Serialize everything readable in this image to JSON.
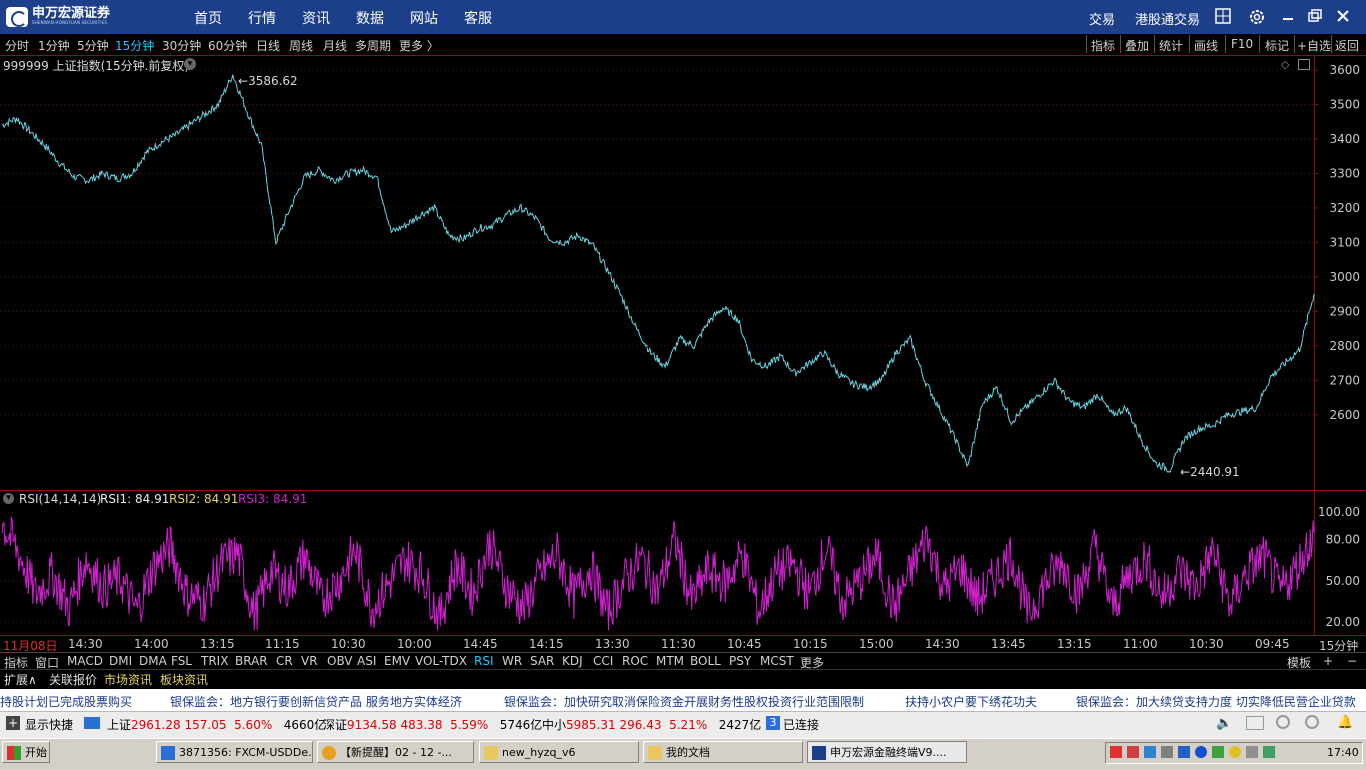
{
  "app": {
    "logo_cn": "申万宏源证券",
    "logo_en": "SHENWAN HONGYUAN SECURITIES",
    "nav": [
      "首页",
      "行情",
      "资讯",
      "数据",
      "网站",
      "客服"
    ],
    "right_links": [
      "交易",
      "港股通交易"
    ]
  },
  "periods": [
    "分时",
    "1分钟",
    "5分钟",
    "15分钟",
    "30分钟",
    "60分钟",
    "日线",
    "周线",
    "月线",
    "多周期",
    "更多 〉"
  ],
  "active_period": "15分钟",
  "right_tools": [
    "指标",
    "叠加",
    "统计",
    "画线",
    "F10",
    "标记",
    "+自选",
    "返回"
  ],
  "main_chart": {
    "title": "999999 上证指数(15分钟.前复权)",
    "high_label": "3586.62",
    "low_label": "2440.91",
    "y_ticks": [
      "3600",
      "3500",
      "3400",
      "3300",
      "3200",
      "3100",
      "3000",
      "2900",
      "2800",
      "2700",
      "2600"
    ]
  },
  "rsi_panel": {
    "name": "RSI(14,14,14)",
    "rsi1": "RSI1: 84.91",
    "rsi2": "RSI2: 84.91",
    "rsi3": "RSI3: 84.91",
    "y_ticks": [
      "100.00",
      "80.00",
      "50.00",
      "20.00"
    ]
  },
  "time_axis": [
    "11月08日",
    "14:30",
    "14:00",
    "13:15",
    "11:15",
    "10:30",
    "10:00",
    "14:45",
    "14:15",
    "13:30",
    "11:30",
    "10:45",
    "10:15",
    "15:00",
    "14:30",
    "13:45",
    "13:15",
    "11:00",
    "10:30",
    "09:45"
  ],
  "time_axis_unit": "15分钟",
  "indicator_tabs": [
    "指标",
    "窗口",
    "MACD",
    "DMI",
    "DMA",
    "FSL",
    "TRIX",
    "BRAR",
    "CR",
    "VR",
    "OBV",
    "ASI",
    "EMV",
    "VOL-TDX",
    "RSI",
    "WR",
    "SAR",
    "KDJ",
    "CCI",
    "ROC",
    "MTM",
    "BOLL",
    "PSY",
    "MCST",
    "更多"
  ],
  "active_indicator": "RSI",
  "indicator_right": [
    "模板",
    "+",
    "−"
  ],
  "news_tabs": [
    "扩展∧",
    "关联报价",
    "市场资讯",
    "板块资讯"
  ],
  "ticker": [
    "持股计划已完成股票购买",
    "银保监会：地方银行要创新信贷产品 服务地方实体经济",
    "银保监会：加快研究取消保险资金开展财务性股权投资行业范围限制",
    "扶持小农户要下绣花功夫",
    "银保监会：加大续贷支持力度 切实降低民营企业贷款"
  ],
  "status": {
    "shortcut": "显示快捷",
    "sh_name": "上证",
    "sh_price": "2961.28",
    "sh_change": "157.05",
    "sh_pct": "5.60%",
    "sh_vol": "4660亿",
    "sz_name": "深证",
    "sz_price": "9134.58",
    "sz_change": "483.38",
    "sz_pct": "5.59%",
    "sz_vol": "5746亿",
    "zx_name": "中小",
    "zx_price": "5985.31",
    "zx_change": "296.43",
    "zx_pct": "5.21%",
    "zx_vol": "2427亿",
    "conn_count": "3",
    "conn_text": "已连接"
  },
  "taskbar": {
    "start": "开始",
    "tasks": [
      "3871356: FXCM-USDDe...",
      "【新提醒】02 - 12 -...",
      "new_hyzq_v6",
      "我的文档",
      "申万宏源金融终端V9...."
    ],
    "clock": "17:40"
  },
  "colors": {
    "price_line": "#5ee0f0",
    "up": "#e03030",
    "rsi": "#d020d0",
    "accent": "#19c9ff",
    "frame": "#8a1010"
  },
  "chart_data": {
    "type": "line",
    "title": "999999 上证指数(15分钟.前复权)",
    "series": [
      {
        "name": "999999 上证指数(15分钟.前复权)",
        "values": [
          3440,
          3460,
          3420,
          3380,
          3330,
          3290,
          3280,
          3300,
          3285,
          3300,
          3360,
          3390,
          3410,
          3440,
          3470,
          3500,
          3586.62,
          3480,
          3380,
          3100,
          3200,
          3290,
          3310,
          3280,
          3300,
          3310,
          3290,
          3130,
          3150,
          3180,
          3200,
          3120,
          3110,
          3140,
          3150,
          3180,
          3200,
          3170,
          3110,
          3100,
          3120,
          3090,
          3020,
          2940,
          2850,
          2780,
          2740,
          2820,
          2800,
          2870,
          2910,
          2880,
          2760,
          2740,
          2770,
          2720,
          2750,
          2780,
          2720,
          2690,
          2680,
          2700,
          2780,
          2820,
          2700,
          2620,
          2540,
          2450,
          2630,
          2680,
          2580,
          2620,
          2660,
          2700,
          2640,
          2620,
          2660,
          2600,
          2620,
          2530,
          2460,
          2440.91,
          2530,
          2560,
          2570,
          2600,
          2610,
          2620,
          2710,
          2750,
          2790,
          2950
        ]
      }
    ],
    "ylim": [
      2440,
      3620
    ],
    "y_ticks": [
      3600,
      3500,
      3400,
      3300,
      3200,
      3100,
      3000,
      2900,
      2800,
      2700,
      2600
    ]
  },
  "rsi_data": {
    "name": "RSI3",
    "values": [
      92,
      70,
      40,
      55,
      30,
      66,
      45,
      52,
      28,
      60,
      75,
      40,
      35,
      62,
      70,
      25,
      58,
      44,
      68,
      36,
      50,
      72,
      30,
      48,
      66,
      55,
      22,
      62,
      40,
      78,
      45,
      30,
      54,
      70,
      38,
      60,
      26,
      50,
      66,
      42,
      80,
      35,
      58,
      48,
      70,
      28,
      55,
      62,
      40,
      74,
      34,
      50,
      68,
      30,
      56,
      82,
      44,
      60,
      36,
      52,
      70,
      25,
      48,
      64,
      40,
      76,
      30,
      54,
      66,
      38,
      58,
      45,
      72,
      32,
      56,
      68,
      42,
      60,
      84.91
    ]
  }
}
